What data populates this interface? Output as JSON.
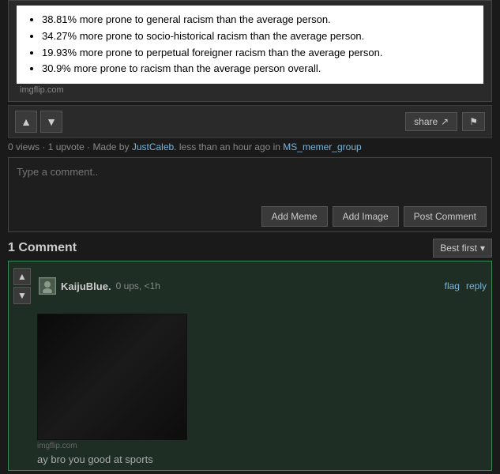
{
  "meme": {
    "stats": [
      "38.81% more prone to general racism than the average person.",
      "34.27% more prone to socio-historical racism than the average person.",
      "19.93% more prone to perpetual foreigner racism than the average person.",
      "30.9% more prone to racism than the average person overall."
    ],
    "footer": "imgflip.com"
  },
  "actionbar": {
    "upvote_label": "▲",
    "downvote_label": "▼",
    "share_label": "share",
    "share_icon": "↗",
    "flag_label": "⚑",
    "views": "0 views",
    "upvotes": "1 upvote",
    "made_by_prefix": "Made by",
    "author": "JustCaleb.",
    "time": "less than an hour ago in",
    "group": "MS_memer_group"
  },
  "comment_input": {
    "placeholder": "Type a comment..",
    "add_meme_label": "Add Meme",
    "add_image_label": "Add Image",
    "post_comment_label": "Post Comment"
  },
  "comments_section": {
    "title": "1 Comment",
    "sort_label": "Best first",
    "sort_icon": "▾"
  },
  "comments": [
    {
      "user": "KaijuBlue.",
      "ups": "0 ups,",
      "time": "<1h",
      "flag_label": "flag",
      "reply_label": "reply",
      "image_footer": "imgflip.com",
      "text": "ay bro you good at sports"
    }
  ]
}
